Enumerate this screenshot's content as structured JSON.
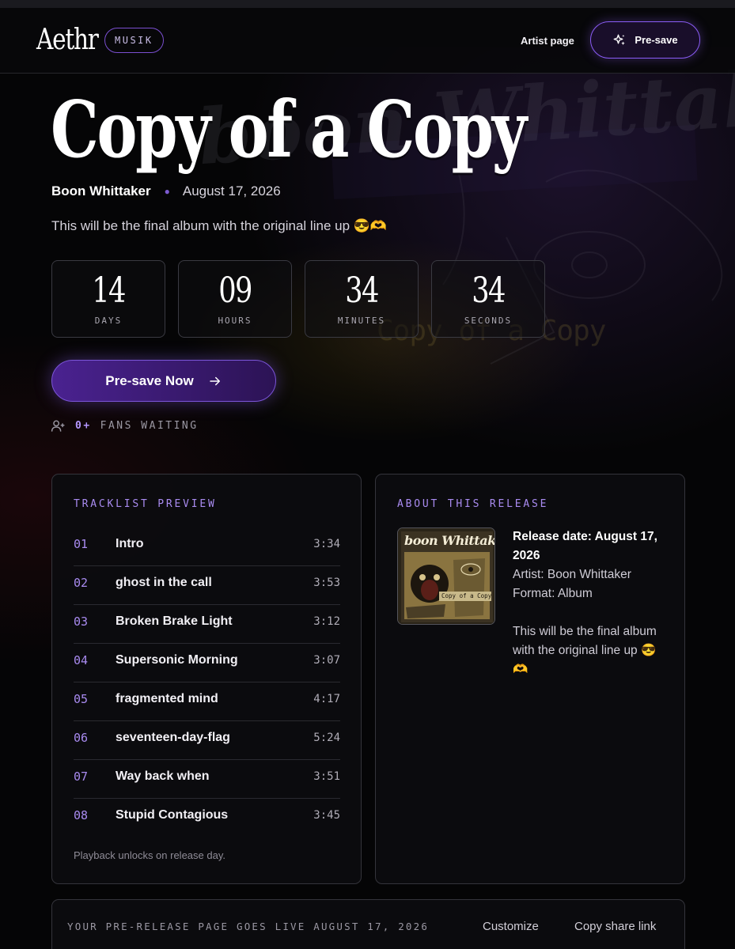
{
  "header": {
    "logo": "Aethr",
    "badge": "MUSIK",
    "artist_page_label": "Artist page",
    "presave_label": "Pre-save"
  },
  "release": {
    "title": "Copy of a Copy",
    "artist": "Boon Whittaker",
    "date": "August 17, 2026",
    "description": "This will be the final album with the original line up 😎🫶"
  },
  "countdown": [
    {
      "value": "14",
      "unit": "DAYS"
    },
    {
      "value": "09",
      "unit": "HOURS"
    },
    {
      "value": "34",
      "unit": "MINUTES"
    },
    {
      "value": "34",
      "unit": "SECONDS"
    }
  ],
  "cta": {
    "label": "Pre-save Now"
  },
  "fans": {
    "count": "0+",
    "label": "FANS WAITING"
  },
  "tracklist": {
    "title": "TRACKLIST PREVIEW",
    "tracks": [
      {
        "no": "01",
        "name": "Intro",
        "duration": "3:34"
      },
      {
        "no": "02",
        "name": "ghost in the call",
        "duration": "3:53"
      },
      {
        "no": "03",
        "name": "Broken Brake Light",
        "duration": "3:12"
      },
      {
        "no": "04",
        "name": "Supersonic Morning",
        "duration": "3:07"
      },
      {
        "no": "05",
        "name": "fragmented mind",
        "duration": "4:17"
      },
      {
        "no": "06",
        "name": "seventeen-day-flag",
        "duration": "5:24"
      },
      {
        "no": "07",
        "name": "Way back when",
        "duration": "3:51"
      },
      {
        "no": "08",
        "name": "Stupid Contagious",
        "duration": "3:45"
      }
    ],
    "note": "Playback unlocks on release day."
  },
  "about": {
    "title": "ABOUT THIS RELEASE",
    "cover_brand": "boon Whittaker",
    "cover_title": "Copy of a Copy",
    "release_date": "Release date: August 17, 2026",
    "artist": "Artist: Boon Whittaker",
    "format": "Format: Album",
    "description": "This will be the final album with the original line up 😎🫶"
  },
  "footer": {
    "live_text": "YOUR PRE-RELEASE PAGE GOES LIVE AUGUST 17, 2026",
    "customize": "Customize",
    "copy_link": "Copy share link"
  },
  "background": {
    "brand_text": "boon Whittaker",
    "title_text": "Copy of a Copy"
  },
  "colors": {
    "accent": "#8b5cf6",
    "accent_text": "#a98bf0",
    "background": "#050506"
  }
}
